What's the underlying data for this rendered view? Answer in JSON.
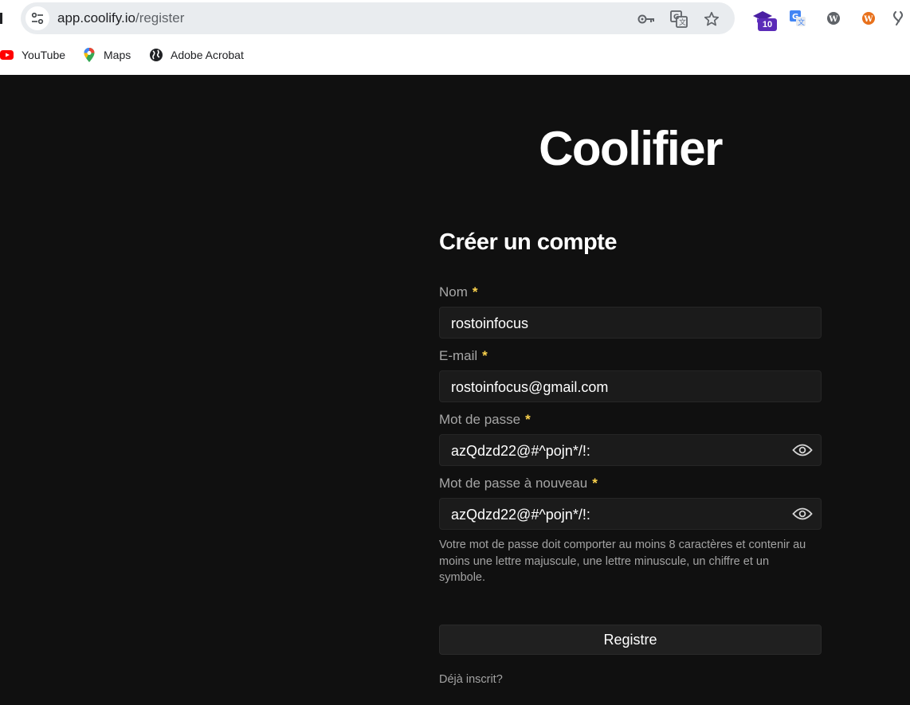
{
  "browser": {
    "url_host": "app.coolify.io",
    "url_path": "/register",
    "extension_badge": "10",
    "bookmarks": [
      {
        "label": "YouTube",
        "icon": "youtube-icon"
      },
      {
        "label": "Maps",
        "icon": "maps-icon"
      },
      {
        "label": "Adobe Acrobat",
        "icon": "globe-icon"
      }
    ]
  },
  "page": {
    "brand": "Coolifier",
    "heading": "Créer un compte",
    "fields": [
      {
        "label": "Nom",
        "required_mark": "*",
        "value": "rostoinfocus"
      },
      {
        "label": "E-mail",
        "required_mark": "*",
        "value": "rostoinfocus@gmail.com"
      },
      {
        "label": "Mot de passe",
        "required_mark": "*",
        "value": "azQdzd22@#^pojn*/!:",
        "icon": "eye-icon"
      },
      {
        "label": "Mot de passe à nouveau",
        "required_mark": "*",
        "value": "azQdzd22@#^pojn*/!:",
        "icon": "eye-icon"
      }
    ],
    "password_hint": "Votre mot de passe doit comporter au moins 8 caractères et contenir au moins une lettre majuscule, une lettre minuscule, un chiffre et un symbole.",
    "submit_label": "Registre",
    "login_link": "Déjà inscrit?"
  },
  "colors": {
    "page_background": "#101010",
    "input_background": "#1b1b1b",
    "required_accent": "#fcd34d",
    "label_text": "#a6a6a6"
  }
}
